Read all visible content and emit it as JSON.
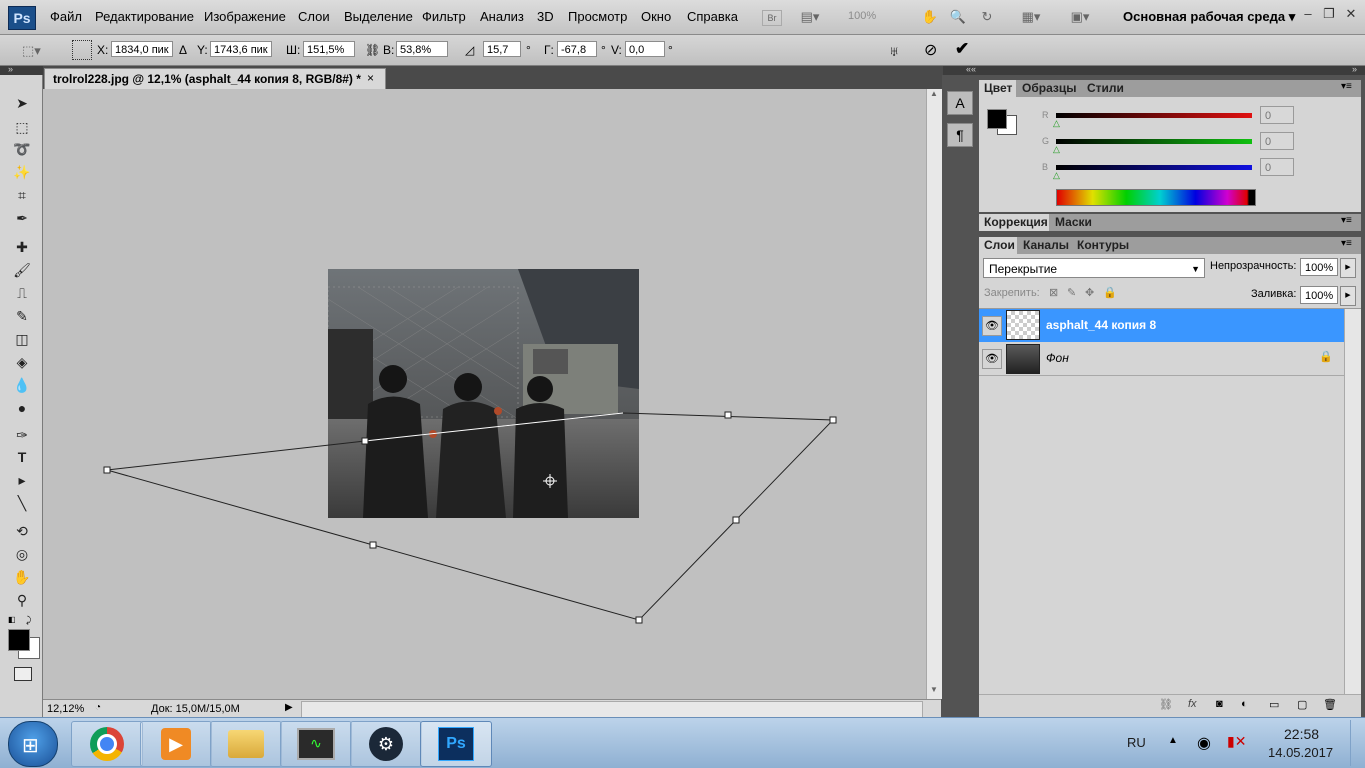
{
  "app": {
    "logo": "Ps",
    "workspace": "Основная рабочая среда ▾"
  },
  "menu": [
    "Файл",
    "Редактирование",
    "Изображение",
    "Слои",
    "Выделение",
    "Фильтр",
    "Анализ",
    "3D",
    "Просмотр",
    "Окно",
    "Справка"
  ],
  "topbar": {
    "bridge": "Br",
    "zoom_select": "100%"
  },
  "options": {
    "x_label": "X:",
    "x_value": "1834,0 пик",
    "y_label": "Y:",
    "y_value": "1743,6 пик",
    "w_label": "Ш:",
    "w_value": "151,5%",
    "h_label": "В:",
    "h_value": "53,8%",
    "angle_value": "15,7",
    "deg": "°",
    "hskew_label": "Г:",
    "hskew_value": "-67,8",
    "vskew_label": "V:",
    "vskew_value": "0,0"
  },
  "document": {
    "title": "trolrol228.jpg @ 12,1% (asphalt_44 копия 8, RGB/8#) *",
    "close": "×",
    "zoom": "12,12%",
    "doc_info": "Док: 15,0M/15,0M"
  },
  "color_panel": {
    "tabs": [
      "Цвет",
      "Образцы",
      "Стили"
    ],
    "channels": [
      {
        "label": "R",
        "value": "0",
        "color": "#d01818"
      },
      {
        "label": "G",
        "value": "0",
        "color": "#18b818"
      },
      {
        "label": "B",
        "value": "0",
        "color": "#1818d0"
      }
    ]
  },
  "adjust_panel": {
    "tabs": [
      "Коррекция",
      "Маски"
    ]
  },
  "layers_panel": {
    "tabs": [
      "Слои",
      "Каналы",
      "Контуры"
    ],
    "blend_mode": "Перекрытие",
    "opacity_label": "Непрозрачность:",
    "opacity_value": "100%",
    "lock_label": "Закрепить:",
    "fill_label": "Заливка:",
    "fill_value": "100%",
    "layers": [
      {
        "name": "asphalt_44 копия 8",
        "selected": true
      },
      {
        "name": "Фон",
        "selected": false
      }
    ]
  },
  "taskbar": {
    "lang": "RU",
    "time": "22:58",
    "date": "14.05.2017",
    "apps": [
      "chrome",
      "media",
      "explorer",
      "task-manager",
      "steam",
      "photoshop"
    ]
  }
}
